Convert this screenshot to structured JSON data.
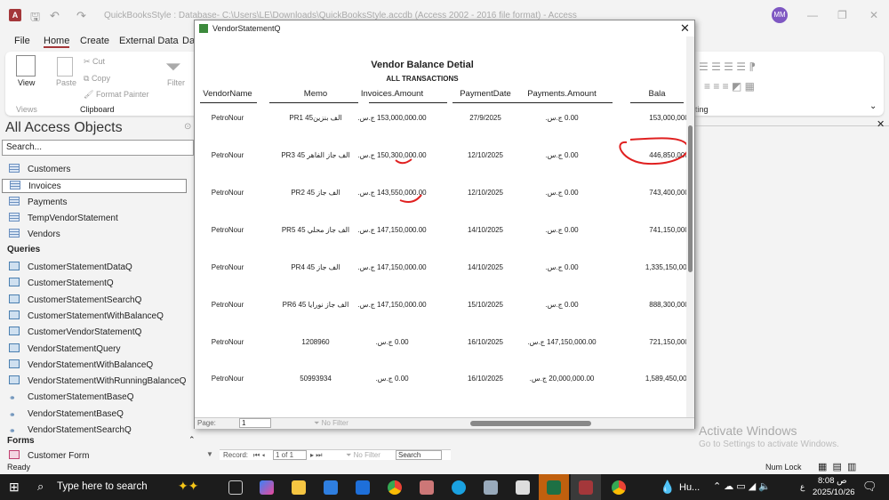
{
  "app": {
    "title": "QuickBooksStyle : Database- C:\\Users\\LE\\Downloads\\QuickBooksStyle.accdb (Access 2002 - 2016 file format) - Access",
    "avatar": "MM"
  },
  "menu": [
    "File",
    "Home",
    "Create",
    "External Data",
    "Da"
  ],
  "ribbon": {
    "view": "View",
    "views": "Views",
    "paste": "Paste",
    "cut": "Cut",
    "copy": "Copy",
    "format_painter": "Format Painter",
    "clipboard": "Clipboard",
    "filter": "Filter",
    "text_formatting": "ting"
  },
  "nav": {
    "title": "All Access Objects",
    "search_placeholder": "Search...",
    "tables": [
      "Customers",
      "Invoices",
      "Payments",
      "TempVendorStatement",
      "Vendors"
    ],
    "queries_label": "Queries",
    "queries": [
      "CustomerStatementDataQ",
      "CustomerStatementQ",
      "CustomerStatementSearchQ",
      "CustomerStatementWithBalanceQ",
      "CustomerVendorStatementQ",
      "VendorStatementQuery",
      "VendorStatementWithBalanceQ",
      "VendorStatementWithRunningBalanceQ"
    ],
    "union_queries": [
      "CustomerStatementBaseQ",
      "VendorStatementBaseQ",
      "VendorStatementSearchQ"
    ],
    "forms_label": "Forms",
    "forms": [
      "Customer Form"
    ]
  },
  "report": {
    "caption": "VendorStatementQ",
    "title": "Vendor Balance Detial",
    "subtitle": "ALL TRANSACTIONS",
    "headers": [
      "VendorName",
      "Memo",
      "Invoices.Amount",
      "PaymentDate",
      "Payments.Amount",
      "Bala"
    ],
    "rows": [
      [
        "PetroNour",
        "PR1 45الف بنزين",
        "153,000,000.00 ج.س.",
        "27/9/2025",
        "0.00 ج.س.",
        "153,000,000."
      ],
      [
        "PetroNour",
        "PR3 45 الف جاز الفاهر",
        "150,300,000.00 ج.س.",
        "12/10/2025",
        "0.00 ج.س.",
        "446,850,000."
      ],
      [
        "PetroNour",
        "PR2 45 الف جاز",
        "143,550,000.00 ج.س.",
        "12/10/2025",
        "0.00 ج.س.",
        "743,400,000."
      ],
      [
        "PetroNour",
        "PR5 45 الف جاز محلي",
        "147,150,000.00 ج.س.",
        "14/10/2025",
        "0.00 ج.س.",
        "741,150,000."
      ],
      [
        "PetroNour",
        "PR4 45 الف جاز",
        "147,150,000.00 ج.س.",
        "14/10/2025",
        "0.00 ج.س.",
        "1,335,150,000"
      ],
      [
        "PetroNour",
        "PR6 45 الف جاز نورايا",
        "147,150,000.00 ج.س.",
        "15/10/2025",
        "0.00 ج.س.",
        "888,300,000."
      ],
      [
        "PetroNour",
        "1208960",
        "0.00 ج.س.",
        "16/10/2025",
        "147,150,000.00 ج.س.",
        "721,150,000."
      ],
      [
        "PetroNour",
        "50993934",
        "0.00 ج.س.",
        "16/10/2025",
        "20,000,000.00 ج.س.",
        "1,589,450,000"
      ]
    ],
    "page_label": "Page:",
    "page_value": "1",
    "no_filter": "No Filter"
  },
  "record_nav": {
    "label": "Record:",
    "value": "1 of 1",
    "no_filter": "No Filter",
    "search": "Search"
  },
  "watermark": {
    "line1": "Activate Windows",
    "line2": "Go to Settings to activate Windows."
  },
  "status": {
    "left": "Ready",
    "num_lock": "Num Lock"
  },
  "taskbar": {
    "search": "Type here to search",
    "weather": "Hu...",
    "time": "8:08 ص",
    "date": "2025/10/26",
    "lang": "ع"
  },
  "colors": {
    "access_red": "#a4373a",
    "annotation": "#e02020",
    "avatar": "#7e57c2"
  }
}
